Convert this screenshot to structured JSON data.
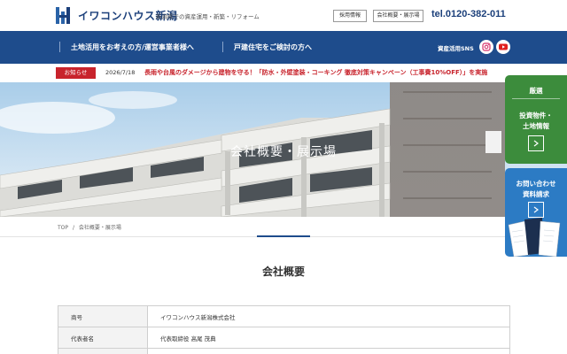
{
  "header": {
    "logo_text": "イワコンハウス新潟",
    "tagline": "新潟県での資産運用・新築・リフォーム",
    "recruit_label": "採用情報",
    "company_label": "会社概要・展示場",
    "tel": "tel.0120-382-011"
  },
  "nav": {
    "items": [
      {
        "label": "土地活用をお考えの方/運営事業者様へ"
      },
      {
        "label": "戸建住宅をご検討の方へ"
      }
    ],
    "sns_label": "資産活用SNS"
  },
  "news": {
    "badge": "お知らせ",
    "date": "2026/7/18",
    "text": "長雨や台風のダメージから建物を守る！「防水・外壁塗装・コーキング 徹底対策キャンペーン（工事費10%OFF）」を実施"
  },
  "hero": {
    "title": "会社概要・展示場"
  },
  "breadcrumb": {
    "items": [
      "TOP",
      "/",
      "会社概要・展示場"
    ]
  },
  "section": {
    "title": "会社概要"
  },
  "company_table": {
    "rows": [
      {
        "label": "商号",
        "value": "イワコンハウス新潟株式会社"
      },
      {
        "label": "代表者名",
        "value": "代表取締役 高尾 茂典"
      },
      {
        "label": "",
        "value": ""
      }
    ]
  },
  "side": {
    "green_top": "厳選",
    "green_main_1": "投資物件・",
    "green_main_2": "土地情報",
    "blue_main_1": "お問い合わせ",
    "blue_main_2": "資料請求"
  },
  "colors": {
    "brand_navy": "#1e4c8c",
    "news_red": "#c8232c",
    "side_green": "#3c8c3c",
    "side_blue": "#2c7bc4"
  },
  "icons": {
    "instagram": "instagram-icon",
    "youtube": "youtube-icon",
    "arrow": "chevron-right-icon"
  }
}
